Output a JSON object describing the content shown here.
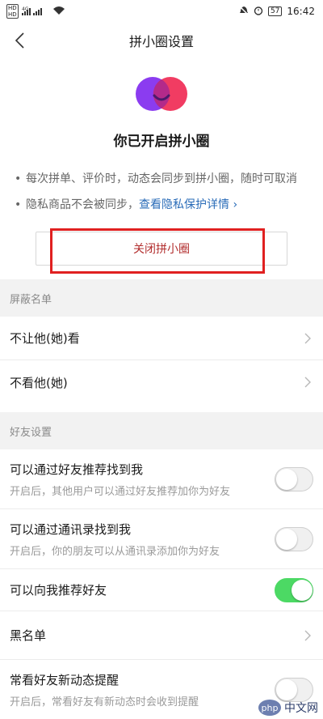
{
  "status_bar": {
    "time": "16:42",
    "battery": "57",
    "signal_label": "4G"
  },
  "nav": {
    "title": "拼小圈设置"
  },
  "hero": {
    "title": "你已开启拼小圈"
  },
  "bullets": {
    "b1": "每次拼单、评价时，动态会同步到拼小圈，随时可取消",
    "b2_text": "隐私商品不会被同步，",
    "b2_link": "查看隐私保护详情 ›"
  },
  "close_button": {
    "label": "关闭拼小圈"
  },
  "block_section": {
    "header": "屏蔽名单",
    "items": [
      {
        "label": "不让他(她)看"
      },
      {
        "label": "不看他(她)"
      }
    ]
  },
  "friend_section": {
    "header": "好友设置",
    "items": [
      {
        "label": "可以通过好友推荐找到我",
        "sub": "开启后，其他用户可以通过好友推荐加你为好友",
        "toggle": false
      },
      {
        "label": "可以通过通讯录找到我",
        "sub": "开启后，你的朋友可以从通讯录添加你为好友",
        "toggle": false
      },
      {
        "label": "可以向我推荐好友",
        "sub": "",
        "toggle": true
      },
      {
        "label": "黑名单",
        "sub": ""
      },
      {
        "label": "常看好友新动态提醒",
        "sub": "开启后，常看好友有新动态时会收到提醒",
        "toggle": false
      }
    ]
  },
  "watermark": {
    "logo": "php",
    "text": "中文网"
  },
  "colors": {
    "accent_link": "#2a6cb8",
    "close_text": "#b22d2d",
    "highlight": "#e02020",
    "toggle_on": "#4cd964",
    "logo_left": "#8b3cf0",
    "logo_right": "#f0325a"
  }
}
